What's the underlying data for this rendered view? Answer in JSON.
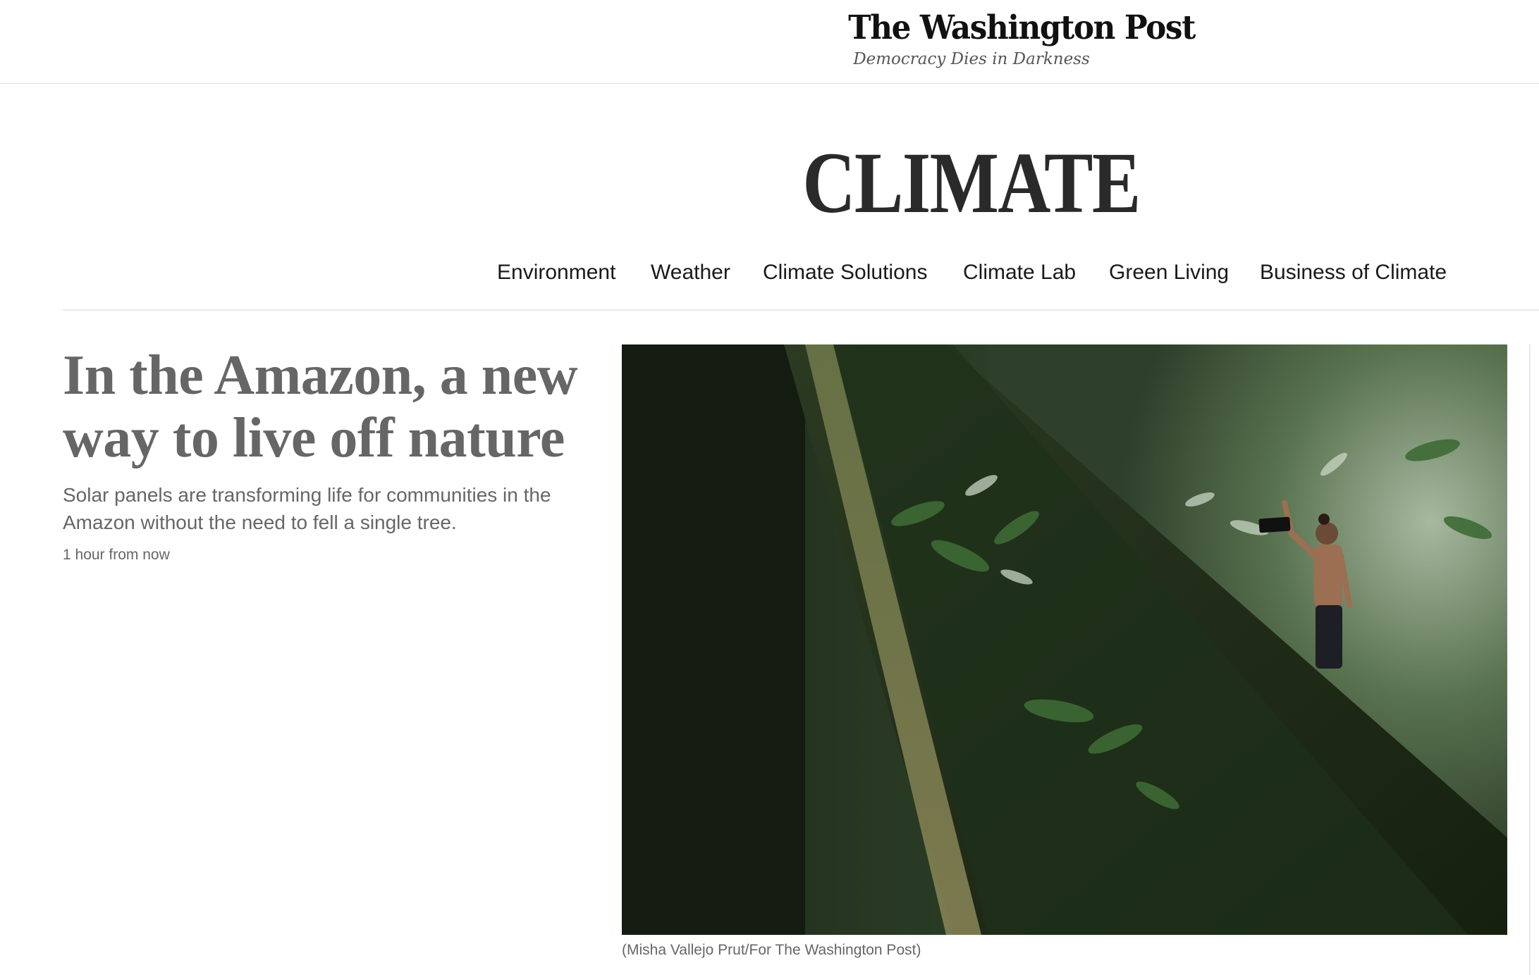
{
  "masthead": {
    "logo_text": "The Washington Post",
    "tagline": "Democracy Dies in Darkness"
  },
  "section": {
    "title": "CLIMATE"
  },
  "subnav": {
    "items": [
      {
        "label": "Environment"
      },
      {
        "label": "Weather"
      },
      {
        "label": "Climate Solutions"
      },
      {
        "label": "Climate Lab"
      },
      {
        "label": "Green Living"
      },
      {
        "label": "Business of Climate"
      }
    ]
  },
  "lead_story": {
    "headline": "In the Amazon, a new way to live off nature",
    "dek": "Solar panels are transforming life for communities in the Amazon without the need to fell a single tree.",
    "timestamp": "1 hour from now",
    "image_caption": "(Misha Vallejo Prut/For The Washington Post)"
  },
  "colors": {
    "headline": "#666666",
    "nav_text": "#1a1a1a",
    "rule": "#e8e8e8"
  }
}
